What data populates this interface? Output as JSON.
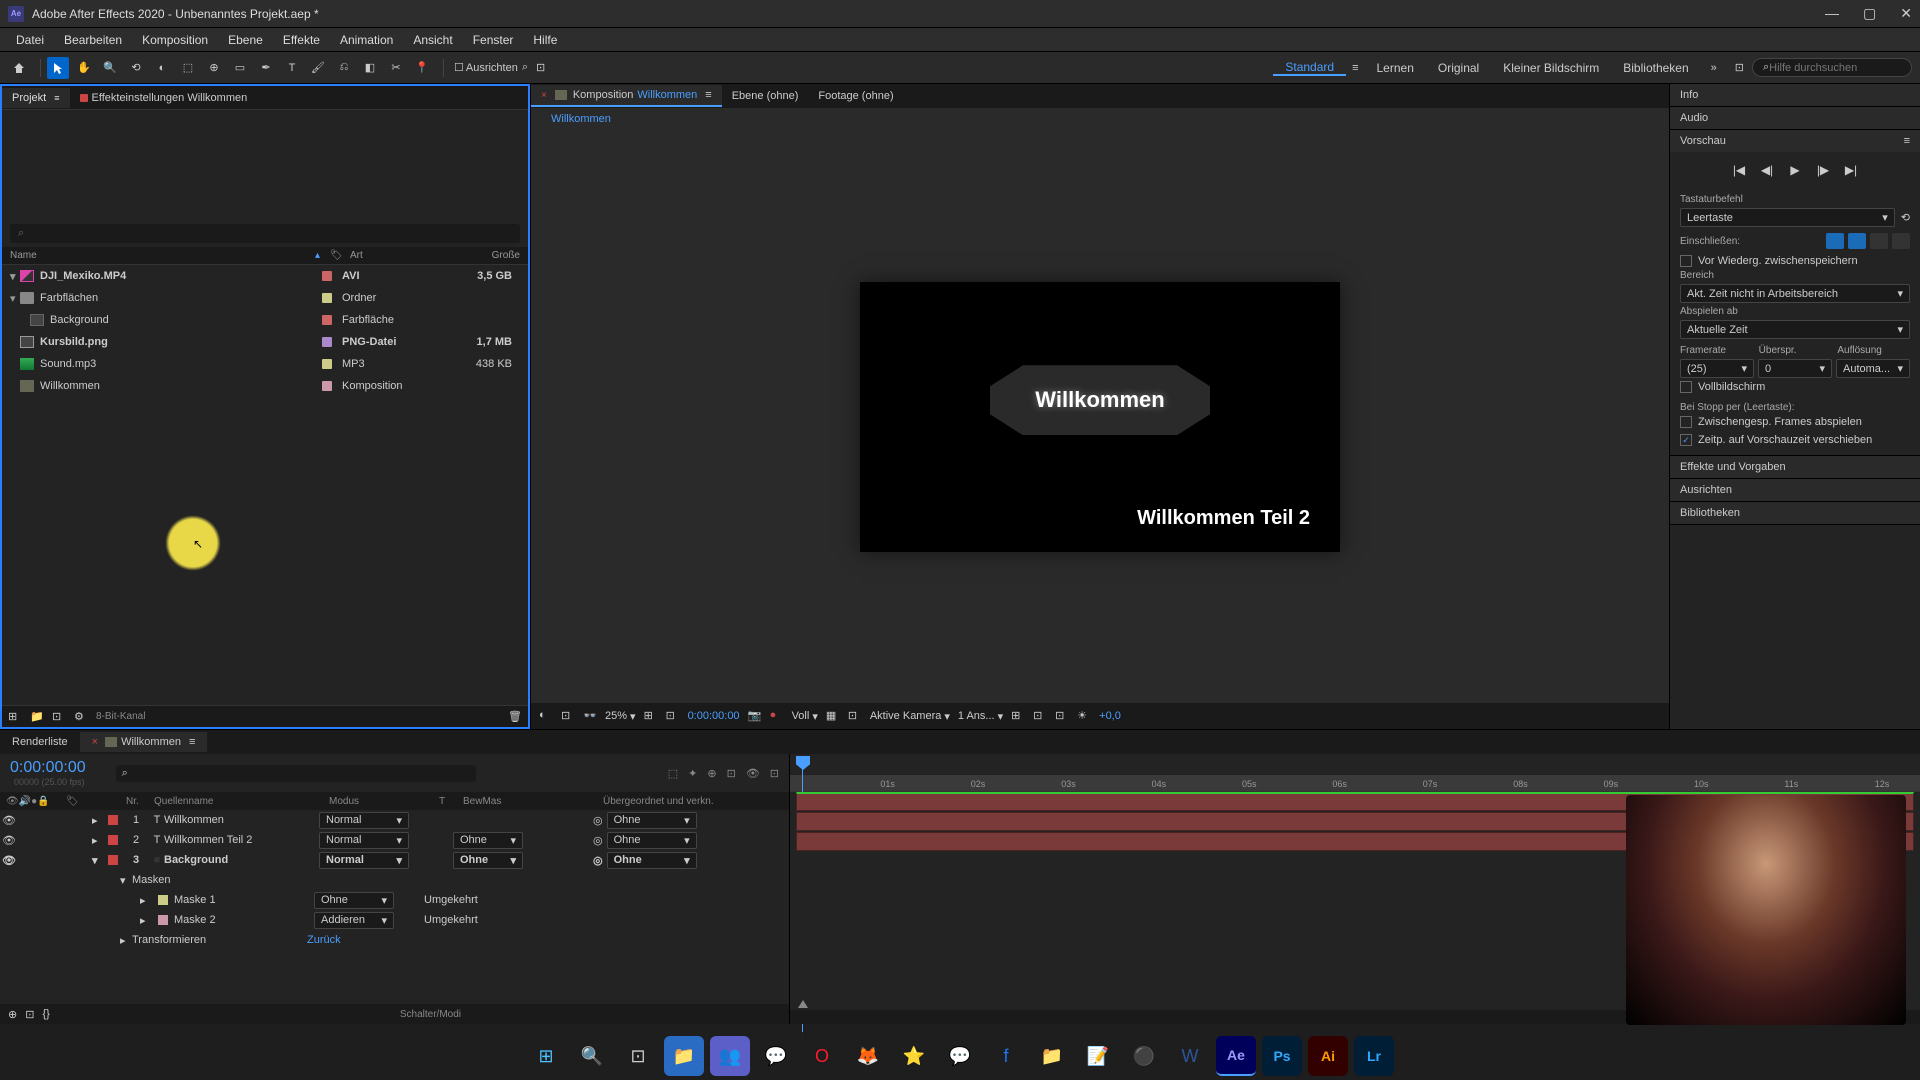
{
  "app": {
    "title": "Adobe After Effects 2020 - Unbenanntes Projekt.aep *",
    "icon_label": "Ae"
  },
  "menu": [
    "Datei",
    "Bearbeiten",
    "Komposition",
    "Ebene",
    "Effekte",
    "Animation",
    "Ansicht",
    "Fenster",
    "Hilfe"
  ],
  "toolbar": {
    "ausrichten": "Ausrichten",
    "workspaces": [
      "Standard",
      "Lernen",
      "Original",
      "Kleiner Bildschirm",
      "Bibliotheken"
    ],
    "search_placeholder": "Hilfe durchsuchen"
  },
  "project": {
    "tabs": {
      "projekt": "Projekt",
      "effekt": "Effekteinstellungen Willkommen"
    },
    "headers": {
      "name": "Name",
      "art": "Art",
      "size": "Große"
    },
    "items": [
      {
        "name": "DJI_Mexiko.MP4",
        "type": "AVI",
        "size": "3,5 GB",
        "bold": true,
        "icon": "video",
        "tag": "#c66",
        "expand": "▾"
      },
      {
        "name": "Farbflächen",
        "type": "Ordner",
        "size": "",
        "icon": "folder",
        "tag": "#cc8",
        "expand": "▾"
      },
      {
        "name": "Background",
        "type": "Farbfläche",
        "size": "",
        "icon": "solid",
        "tag": "#c66",
        "indent": 1
      },
      {
        "name": "Kursbild.png",
        "type": "PNG-Datei",
        "size": "1,7 MB",
        "bold": true,
        "icon": "image",
        "tag": "#a8c"
      },
      {
        "name": "Sound.mp3",
        "type": "MP3",
        "size": "438 KB",
        "icon": "audio",
        "tag": "#cc8"
      },
      {
        "name": "Willkommen",
        "type": "Komposition",
        "size": "",
        "icon": "comp",
        "tag": "#c9a"
      }
    ],
    "footer_bpc": "8-Bit-Kanal"
  },
  "comp": {
    "tabs": {
      "komposition_label": "Komposition",
      "komposition_name": "Willkommen",
      "ebene": "Ebene (ohne)",
      "footage": "Footage (ohne)"
    },
    "breadcrumb": "Willkommen",
    "text1": "Willkommen",
    "text2": "Willkommen Teil 2",
    "footer": {
      "zoom": "25%",
      "time": "0:00:00:00",
      "res": "Voll",
      "camera": "Aktive Kamera",
      "views": "1 Ans...",
      "exposure": "+0,0"
    }
  },
  "right": {
    "info": "Info",
    "audio": "Audio",
    "vorschau": "Vorschau",
    "tastatur_label": "Tastaturbefehl",
    "tastatur_value": "Leertaste",
    "einschliessen": "Einschließen:",
    "cache": "Vor Wiederg. zwischenspeichern",
    "bereich": "Bereich",
    "bereich_value": "Akt. Zeit nicht in Arbeitsbereich",
    "abspielen": "Abspielen ab",
    "abspielen_value": "Aktuelle Zeit",
    "framerate": "Framerate",
    "ueberspr": "Überspr.",
    "aufloesung": "Auflösung",
    "fr_val": "(25)",
    "skip_val": "0",
    "res_val": "Automa...",
    "vollbild": "Vollbildschirm",
    "stopp": "Bei Stopp per (Leertaste):",
    "frames_abspielen": "Zwischengesp. Frames abspielen",
    "zeitp": "Zeitp. auf Vorschauzeit verschieben",
    "effekte": "Effekte und Vorgaben",
    "ausrichten_p": "Ausrichten",
    "bibliotheken": "Bibliotheken"
  },
  "timeline": {
    "render_tab": "Renderliste",
    "comp_tab": "Willkommen",
    "timecode": "0:00:00:00",
    "timecode_sub": "00000 (25.00 fps)",
    "headers": {
      "nr": "Nr.",
      "quelle": "Quellenname",
      "modus": "Modus",
      "t": "T",
      "bm": "BewMas",
      "parent": "Übergeordnet und verkn."
    },
    "layers": [
      {
        "num": "1",
        "name": "Willkommen",
        "icon": "T",
        "mode": "Normal",
        "bm": "",
        "parent": "Ohne",
        "color": "#c44"
      },
      {
        "num": "2",
        "name": "Willkommen Teil 2",
        "icon": "T",
        "mode": "Normal",
        "bm": "Ohne",
        "parent": "Ohne",
        "color": "#c44"
      },
      {
        "num": "3",
        "name": "Background",
        "icon": "■",
        "mode": "Normal",
        "bm": "Ohne",
        "parent": "Ohne",
        "color": "#c44",
        "bold": true,
        "expanded": true
      }
    ],
    "masken": "Masken",
    "mask_items": [
      {
        "name": "Maske 1",
        "mode": "Ohne",
        "inv": "Umgekehrt",
        "color": "#cc8"
      },
      {
        "name": "Maske 2",
        "mode": "Addieren",
        "inv": "Umgekehrt",
        "color": "#c9a"
      }
    ],
    "transform": "Transformieren",
    "zuruck": "Zurück",
    "schalter": "Schalter/Modi",
    "time_marks": [
      "01s",
      "02s",
      "03s",
      "04s",
      "05s",
      "06s",
      "07s",
      "08s",
      "09s",
      "10s",
      "11s",
      "12s"
    ]
  },
  "taskbar": {
    "icons": [
      "windows",
      "search",
      "tasks",
      "explorer",
      "teams",
      "whatsapp",
      "opera",
      "firefox",
      "anki",
      "messenger",
      "facebook",
      "files",
      "notepad",
      "obs",
      "word",
      "ae",
      "ps",
      "ai",
      "lr"
    ]
  }
}
